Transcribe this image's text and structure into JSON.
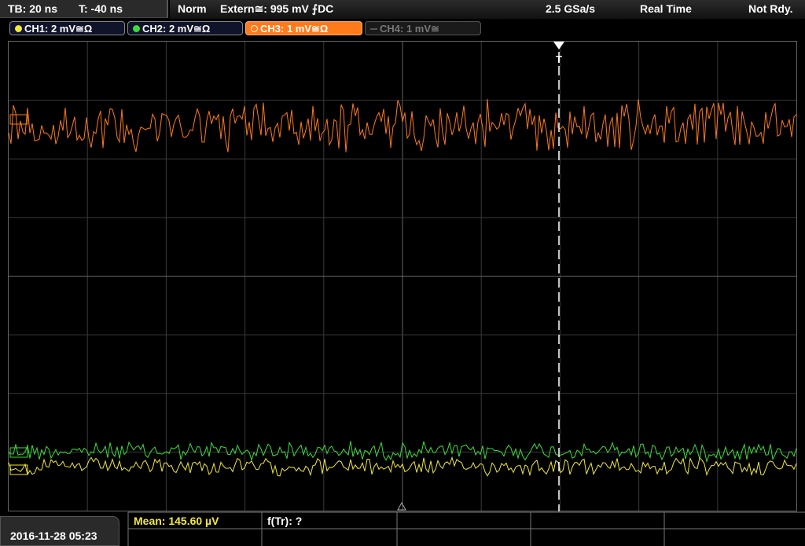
{
  "header": {
    "tb": "TB: 20 ns",
    "trig_time": "T: -40 ns",
    "mode": "Norm",
    "trigger": "Extern≅: 995 mV ⨍DC",
    "sample_rate": "2.5 GSa/s",
    "acq_mode": "Real Time",
    "status": "Not Rdy."
  },
  "channels": [
    {
      "label": "CH1: 2 mV≅Ω",
      "color": "#f2e93a"
    },
    {
      "label": "CH2: 2 mV≅Ω",
      "color": "#3ddc3d"
    },
    {
      "label": "CH3: 1 mV≅Ω",
      "color": "#ff7a1a"
    },
    {
      "label": "CH4: 1 mV≅",
      "color": "#777777"
    }
  ],
  "trigger_marker": "T",
  "footer": {
    "datetime": "2016-11-28 05:23",
    "mean": "Mean: 145.60 µV",
    "freq": "f(Tr): ?"
  },
  "colors": {
    "ch1": "#f2e93a",
    "ch2": "#3ddc3d",
    "ch3": "#ff7a1a",
    "grid": "#444444",
    "trigger_line": "#ffffff"
  }
}
